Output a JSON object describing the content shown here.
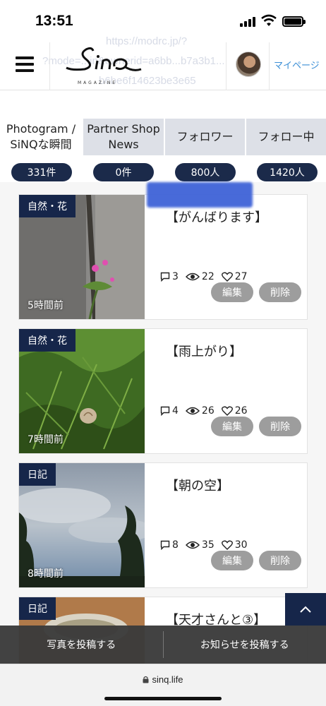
{
  "status": {
    "time": "13:51"
  },
  "header": {
    "logo_text": "Sinq",
    "logo_sub": "MAGAZINE",
    "mypage": "マイページ",
    "ghost_lines": [
      "https://modrc.jp/?",
      "?mode=...in&ownerid=a6bb...b7a3b1...",
      "b6be6f14623be3e65"
    ]
  },
  "tabs": [
    {
      "label1": "Photogram /",
      "label2": "SiNQな瞬間"
    },
    {
      "label1": "Partner Shop",
      "label2": "News"
    },
    {
      "label1": "フォロワー",
      "label2": ""
    },
    {
      "label1": "フォロー中",
      "label2": ""
    }
  ],
  "counts": [
    "331件",
    "0件",
    "800人",
    "1420人"
  ],
  "posts": [
    {
      "category": "自然・花",
      "title": "【がんばります】",
      "ago": "5時間前",
      "comments": "3",
      "views": "22",
      "likes": "27",
      "edit": "編集",
      "delete": "削除"
    },
    {
      "category": "自然・花",
      "title": "【雨上がり】",
      "ago": "7時間前",
      "comments": "4",
      "views": "26",
      "likes": "26",
      "edit": "編集",
      "delete": "削除"
    },
    {
      "category": "日記",
      "title": "【朝の空】",
      "ago": "8時間前",
      "comments": "8",
      "views": "35",
      "likes": "30",
      "edit": "編集",
      "delete": "削除"
    },
    {
      "category": "日記",
      "title": "【天才さんと③】"
    }
  ],
  "bottom": {
    "post_photo": "写真を投稿する",
    "post_news": "お知らせを投稿する"
  },
  "browser": {
    "url": "sinq.life"
  },
  "colors": {
    "navy": "#16264a",
    "tab_bg": "#dde0e7",
    "link": "#3b8fd6"
  }
}
